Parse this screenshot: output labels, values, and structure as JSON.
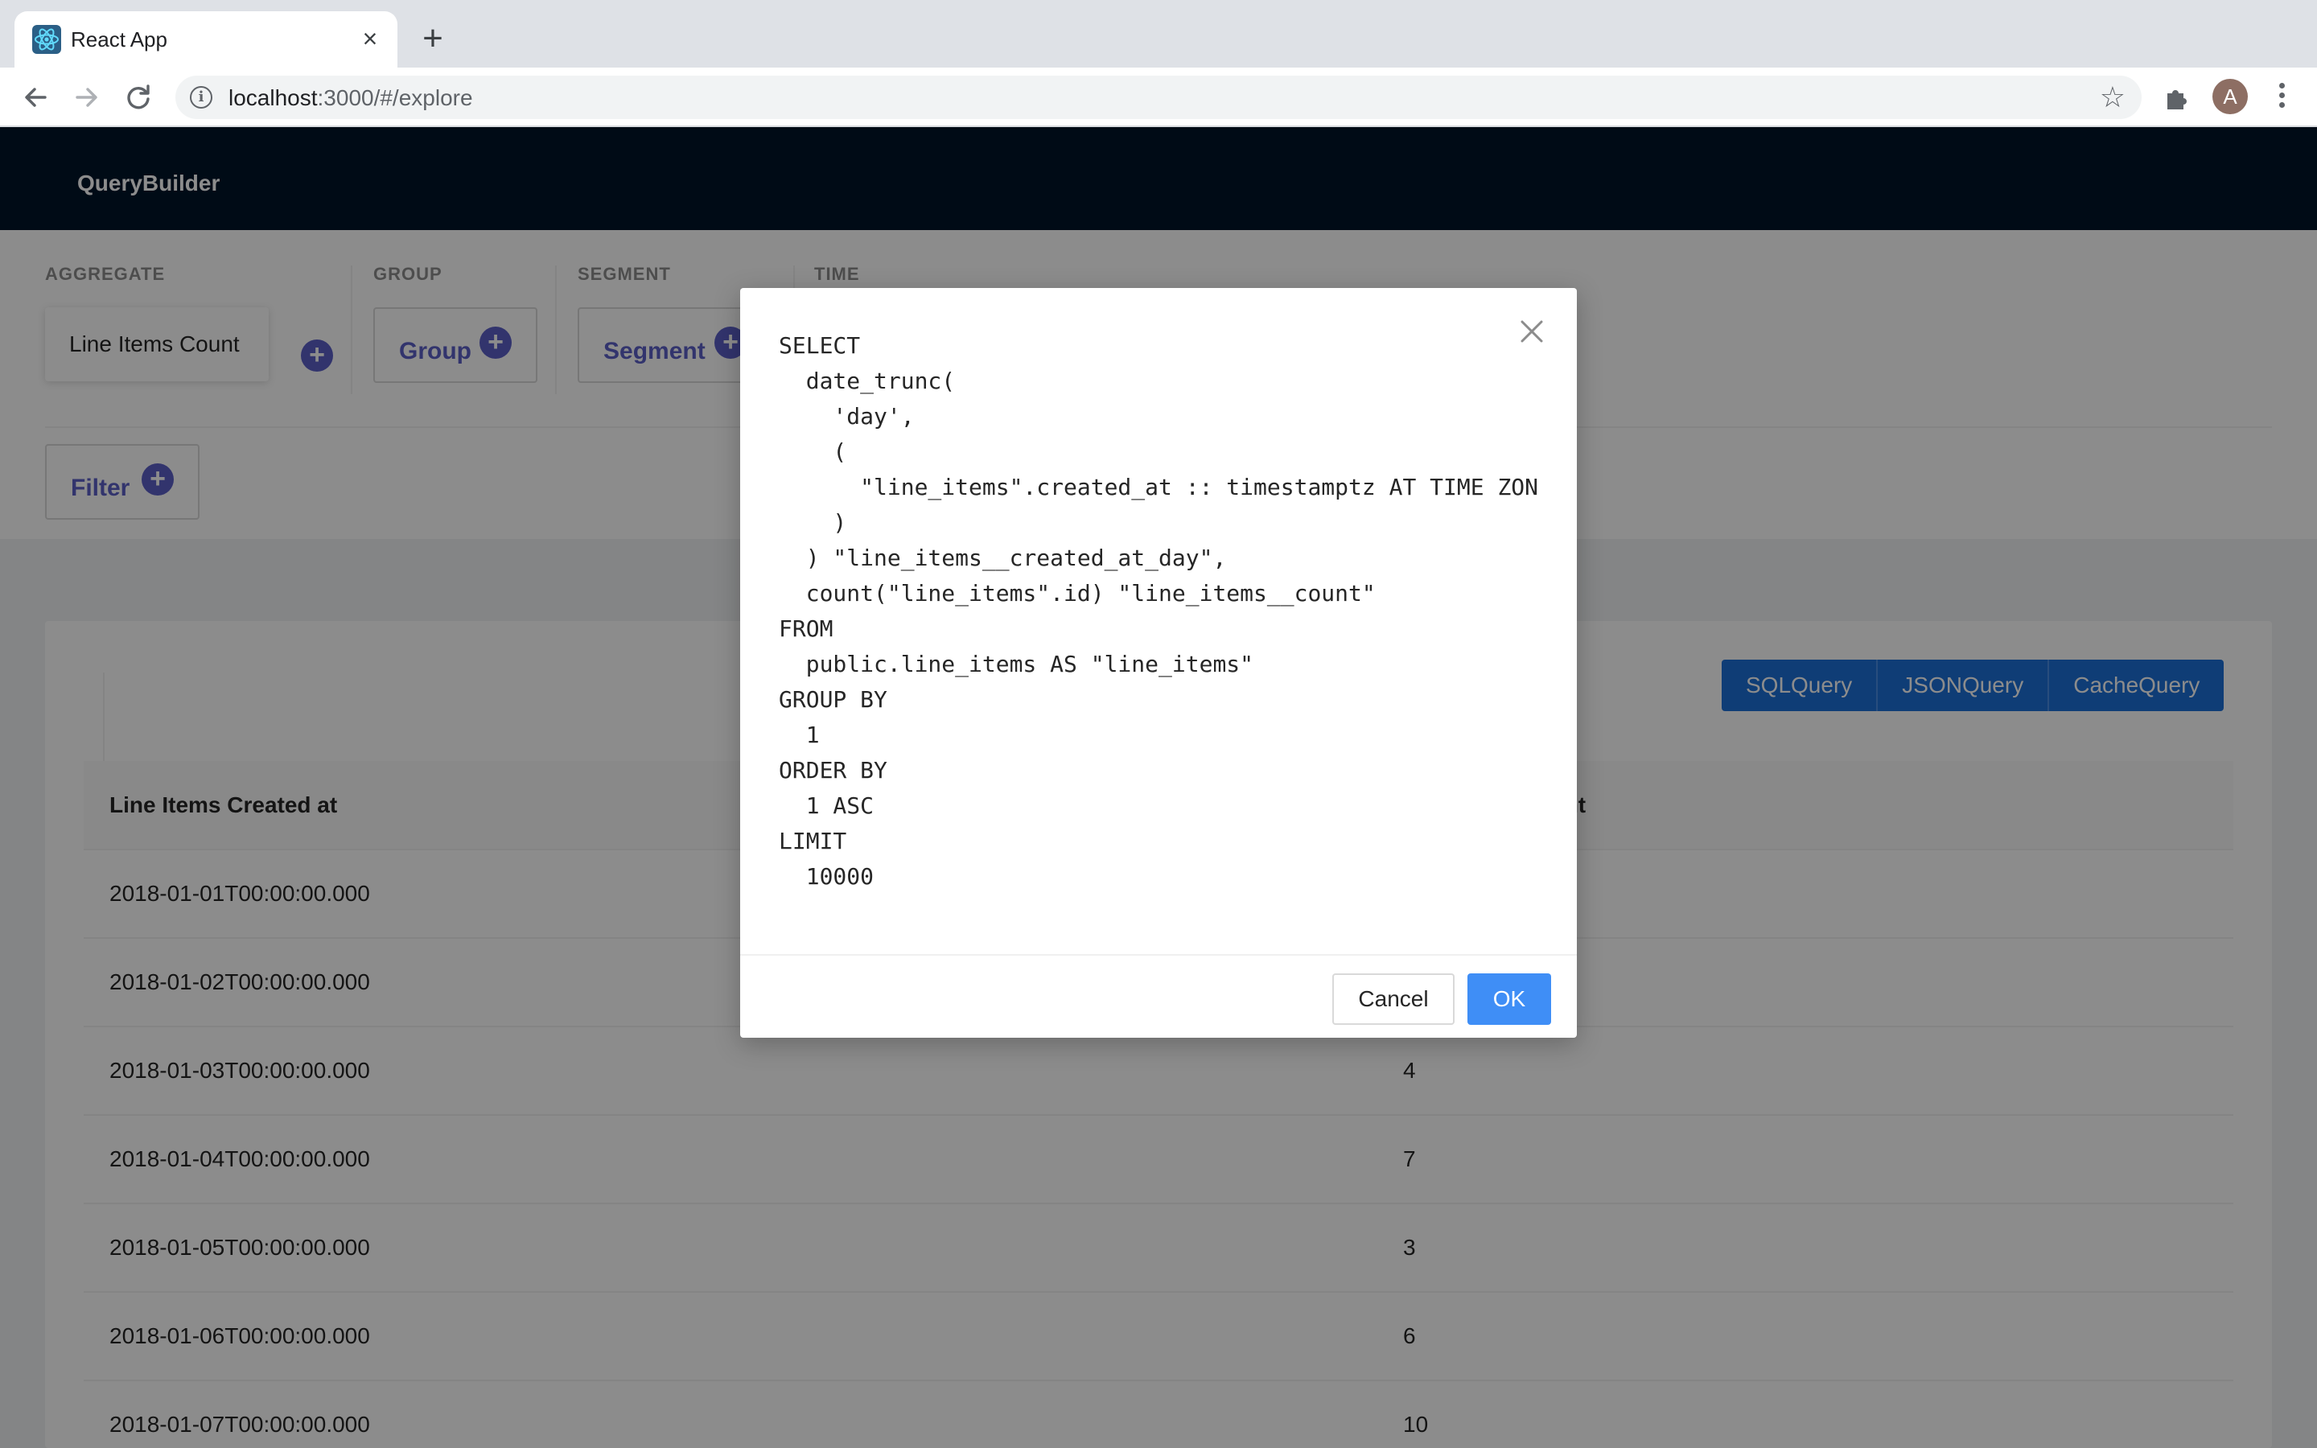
{
  "browser": {
    "tab_title": "React App",
    "url_host": "localhost",
    "url_path": ":3000/#/explore",
    "avatar_initial": "A",
    "close_glyph": "×",
    "new_tab_glyph": "+",
    "star_glyph": "☆",
    "info_glyph": "i"
  },
  "app": {
    "brand": "QueryBuilder",
    "sections": {
      "aggregate": "AGGREGATE",
      "group": "GROUP",
      "segment": "SEGMENT",
      "time": "TIME"
    },
    "measure_label": "Line Items Count",
    "group_button": "Group",
    "segment_button": "Segment",
    "filter_button": "Filter",
    "plus_glyph": "+"
  },
  "query_buttons": [
    "SQLQuery",
    "JSONQuery",
    "CacheQuery"
  ],
  "table": {
    "columns": [
      "Line Items Created at",
      "Line Items Count"
    ],
    "rows": [
      [
        "2018-01-01T00:00:00.000",
        ""
      ],
      [
        "2018-01-02T00:00:00.000",
        ""
      ],
      [
        "2018-01-03T00:00:00.000",
        "4"
      ],
      [
        "2018-01-04T00:00:00.000",
        "7"
      ],
      [
        "2018-01-05T00:00:00.000",
        "3"
      ],
      [
        "2018-01-06T00:00:00.000",
        "6"
      ],
      [
        "2018-01-07T00:00:00.000",
        "10"
      ]
    ]
  },
  "modal": {
    "sql_lines": [
      "SELECT",
      "  date_trunc(",
      "    'day',",
      "    (",
      "      \"line_items\".created_at :: timestamptz AT TIME ZON",
      "    )",
      "  ) \"line_items__created_at_day\",",
      "  count(\"line_items\".id) \"line_items__count\"",
      "FROM",
      "  public.line_items AS \"line_items\"",
      "GROUP BY",
      "  1",
      "ORDER BY",
      "  1 ASC",
      "LIMIT",
      "  10000"
    ],
    "cancel_label": "Cancel",
    "ok_label": "OK"
  }
}
